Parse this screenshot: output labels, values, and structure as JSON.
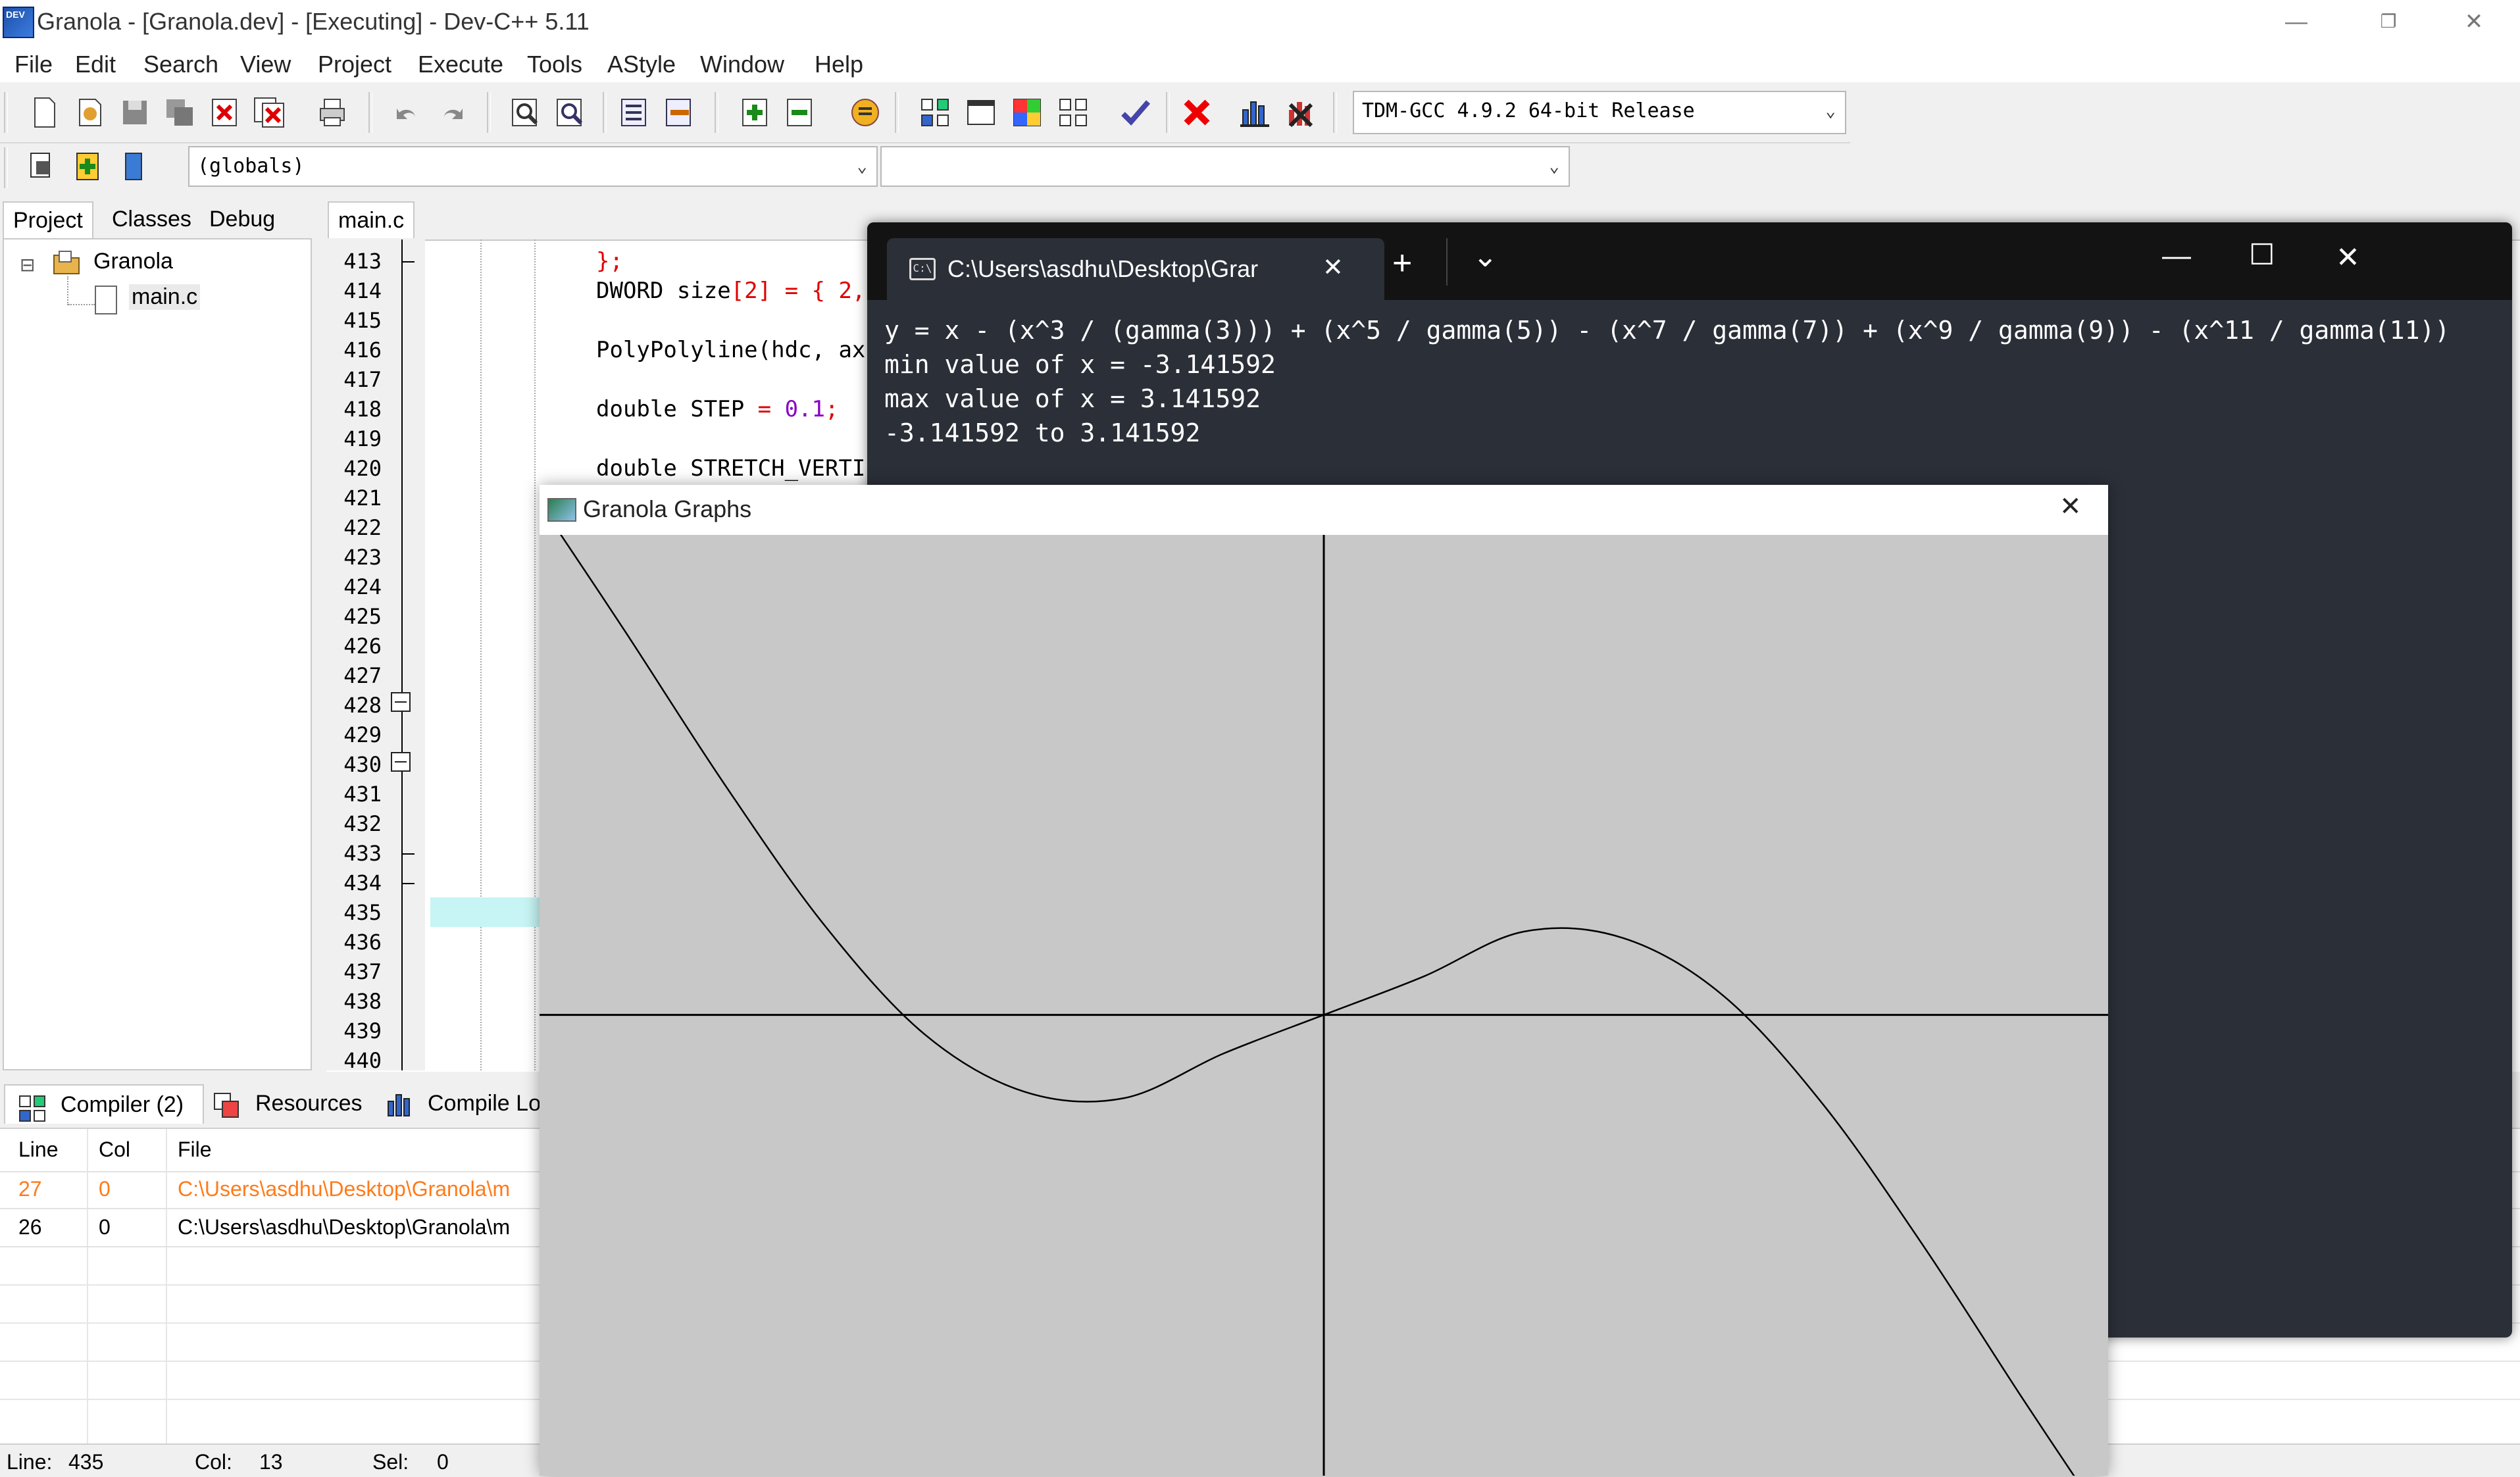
{
  "window": {
    "title": "Granola - [Granola.dev] - [Executing] - Dev-C++ 5.11",
    "app_icon_text": "DEV",
    "minimize": "—",
    "restore": "❐",
    "close": "✕"
  },
  "menu": [
    "File",
    "Edit",
    "Search",
    "View",
    "Project",
    "Execute",
    "Tools",
    "AStyle",
    "Window",
    "Help"
  ],
  "toolbar": {
    "compiler_select": "TDM-GCC 4.9.2 64-bit Release",
    "scope_select": "(globals)",
    "member_select": ""
  },
  "project_panel": {
    "tabs": [
      "Project",
      "Classes",
      "Debug"
    ],
    "tree": {
      "project": "Granola",
      "expander": "⊟",
      "file": "main.c"
    }
  },
  "editor": {
    "tab": "main.c",
    "line_numbers": [
      "413",
      "414",
      "415",
      "416",
      "417",
      "418",
      "419",
      "420",
      "421",
      "422",
      "423",
      "424",
      "425",
      "426",
      "427",
      "428",
      "429",
      "430",
      "431",
      "432",
      "433",
      "434",
      "435",
      "436",
      "437",
      "438",
      "439",
      "440"
    ],
    "code_lines": {
      "l413": "};",
      "l414_a": "DWORD size",
      "l414_b": "[2]",
      "l414_c": " = { 2,",
      "l416_a": "PolyPolyline(hdc, ax",
      "l418_a": "double STEP ",
      "l418_b": "= ",
      "l418_c": "0.1",
      "l418_d": ";",
      "l420_a": "double STRETCH_VERTI"
    }
  },
  "bottom_panel": {
    "tabs": [
      "Compiler (2)",
      "Resources",
      "Compile Lo"
    ],
    "columns": [
      "Line",
      "Col",
      "File"
    ],
    "rows": [
      {
        "line": "27",
        "col": "0",
        "file": "C:\\Users\\asdhu\\Desktop\\Granola\\m",
        "highlight": true
      },
      {
        "line": "26",
        "col": "0",
        "file": "C:\\Users\\asdhu\\Desktop\\Granola\\m",
        "highlight": false
      }
    ]
  },
  "status": {
    "line_label": "Line:",
    "line": "435",
    "col_label": "Col:",
    "col": "13",
    "sel_label": "Sel:",
    "sel": "0"
  },
  "terminal": {
    "tab_title": "C:\\Users\\asdhu\\Desktop\\Grar",
    "tab_close": "✕",
    "new_tab": "+",
    "dropdown": "⌄",
    "minimize": "—",
    "maximize": "☐",
    "close": "✕",
    "lines": [
      "y = x - (x^3 / (gamma(3))) + (x^5 / gamma(5)) - (x^7 / gamma(7)) + (x^9 / gamma(9)) - (x^11 / gamma(11))",
      "min value of x = -3.141592",
      "max value of x = 3.141592",
      "-3.141592 to 3.141592"
    ]
  },
  "graph_window": {
    "title": "Granola Graphs",
    "close": "✕"
  },
  "chart_data": {
    "type": "line",
    "title": "",
    "xlabel": "",
    "ylabel": "",
    "x": [
      -3.141592,
      -2.8,
      -2.4,
      -2.0,
      -1.6,
      -1.2,
      -0.8,
      -0.4,
      0.0,
      0.4,
      0.8,
      1.2,
      1.6,
      2.0,
      2.4,
      2.8,
      3.141592
    ],
    "series": [
      {
        "values": [
          8.0,
          6.0,
          3.6,
          1.4,
          -0.3,
          -1.2,
          -1.3,
          -0.6,
          0.0,
          0.6,
          1.3,
          1.2,
          0.3,
          -1.4,
          -3.6,
          -6.0,
          -8.0
        ]
      }
    ],
    "xlim": [
      -3.141592,
      3.141592
    ],
    "ylim": [
      -7.2,
      7.5
    ],
    "grid": false,
    "axes_through_origin": true,
    "background": "#c8c8c8",
    "line_color": "#000000"
  }
}
